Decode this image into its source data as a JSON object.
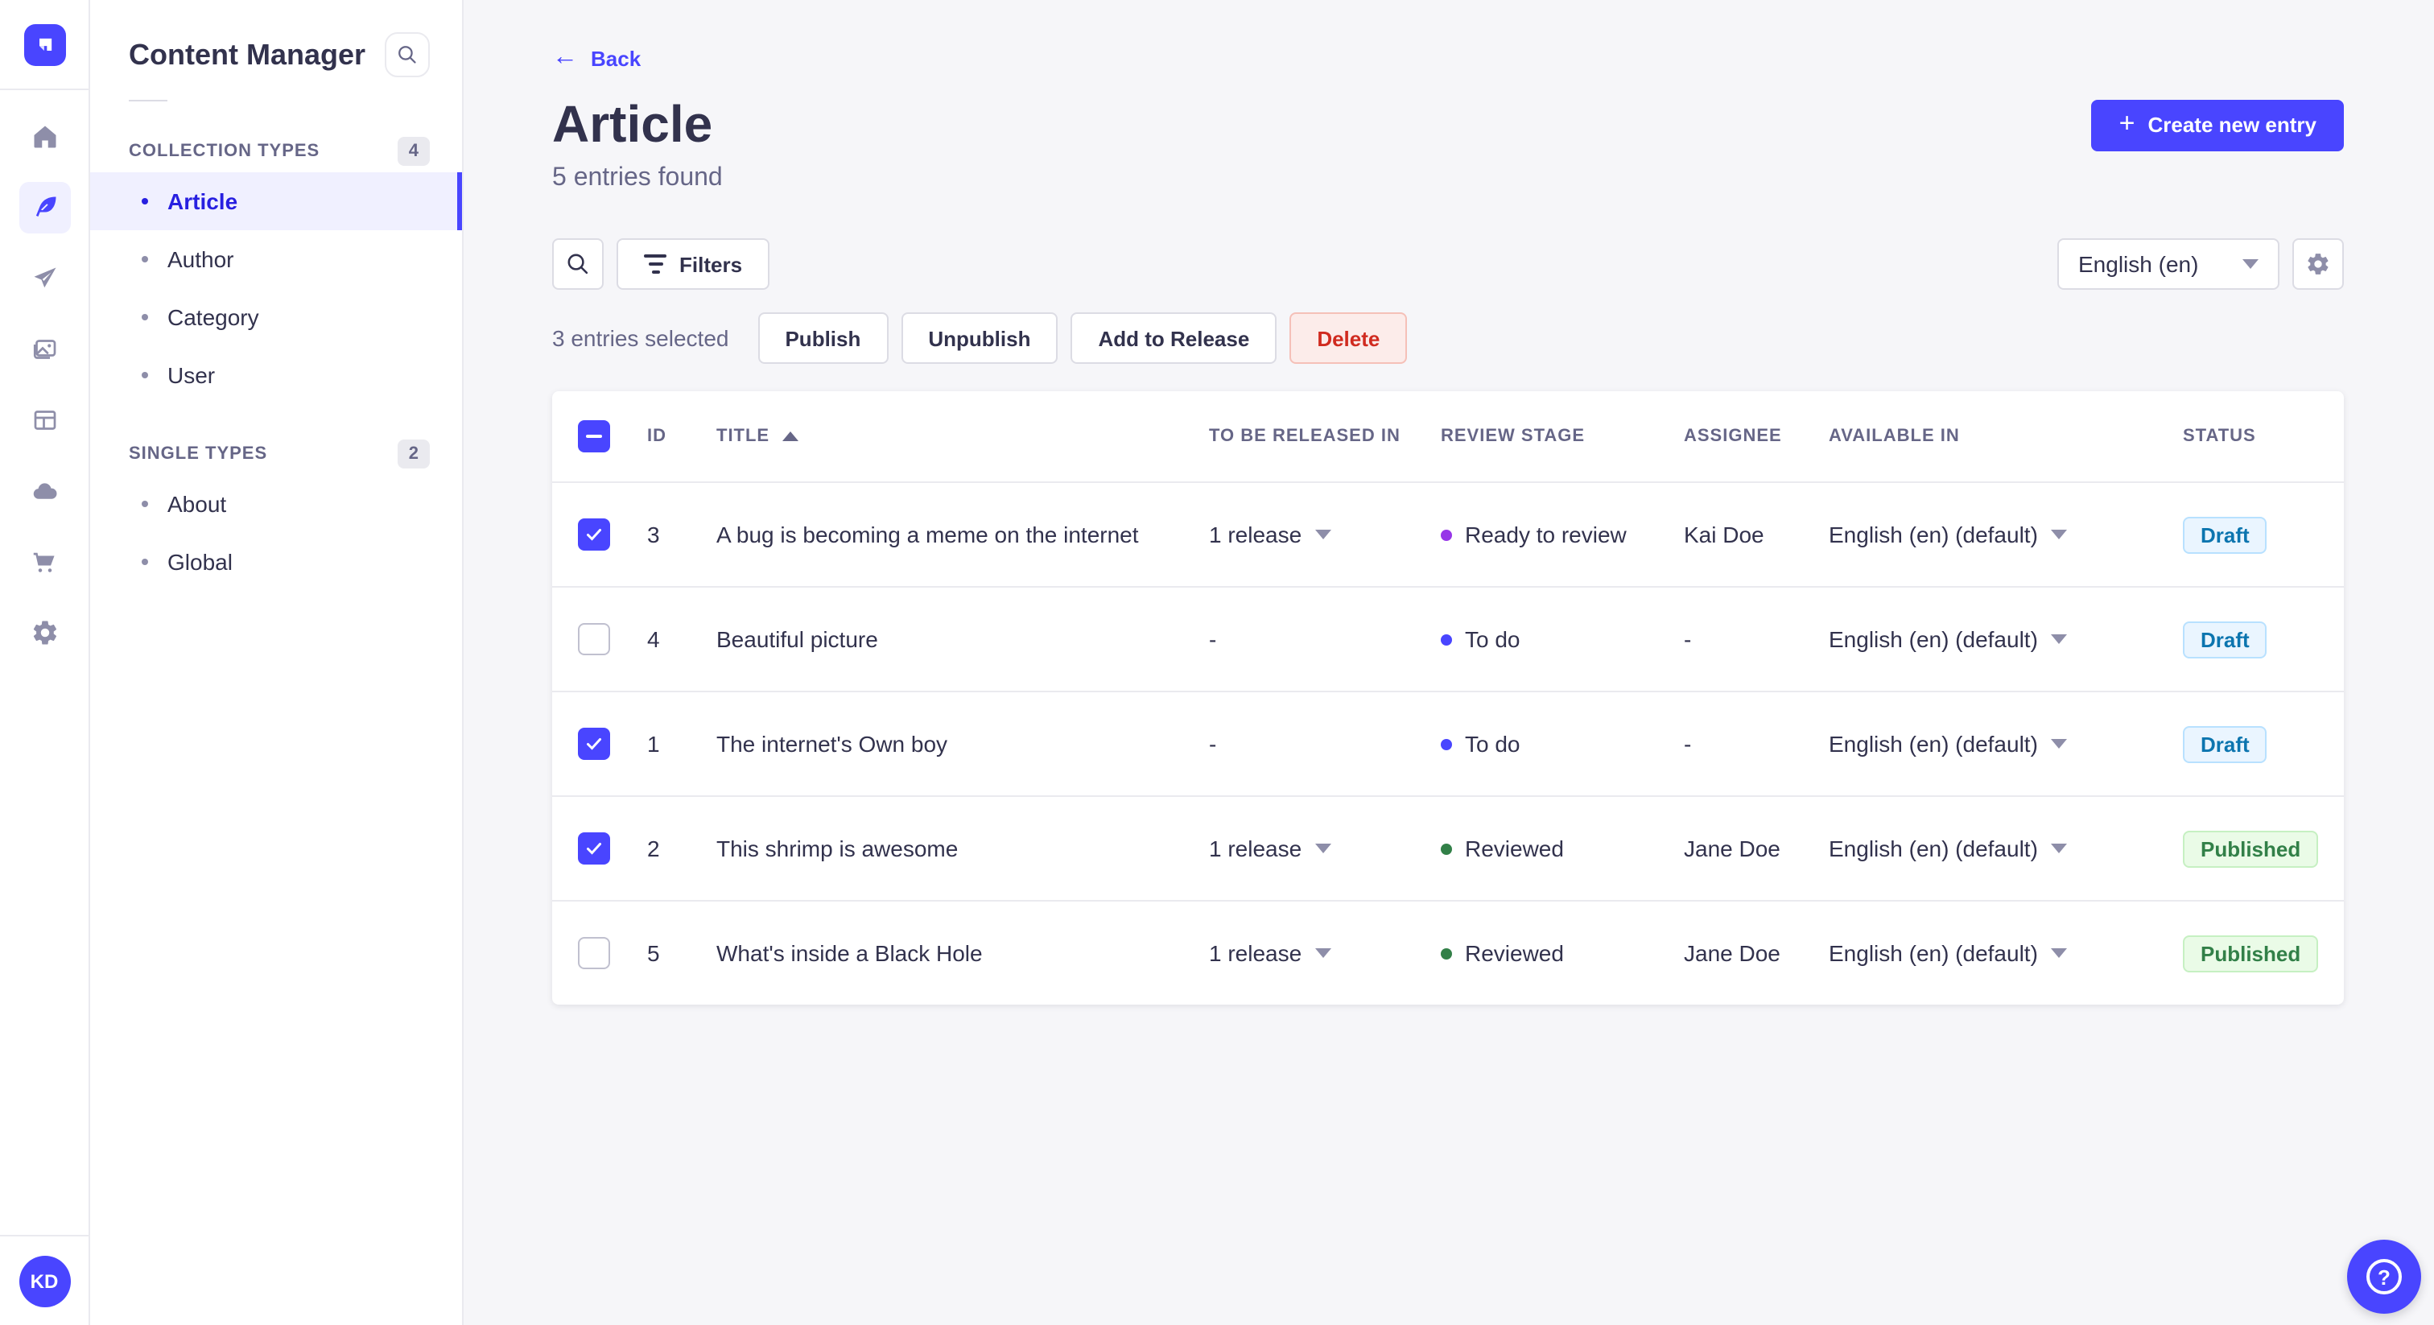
{
  "colors": {
    "primary": "#4945FF",
    "active_text": "#271FE0",
    "draft_text": "#0C75AF",
    "published_text": "#328048",
    "danger_text": "#D02B20"
  },
  "rail": {
    "icons": [
      "strapi-logo-icon",
      "home-icon",
      "feather-content-icon",
      "paper-plane-icon",
      "media-images-icon",
      "layout-icon",
      "cloud-icon",
      "cart-icon",
      "gear-icon"
    ],
    "avatar_initials": "KD"
  },
  "subnav": {
    "title": "Content Manager",
    "search_icon": "search-icon",
    "sections": [
      {
        "label": "COLLECTION TYPES",
        "count": "4",
        "items": [
          {
            "label": "Article",
            "active": true
          },
          {
            "label": "Author",
            "active": false
          },
          {
            "label": "Category",
            "active": false
          },
          {
            "label": "User",
            "active": false
          }
        ]
      },
      {
        "label": "SINGLE TYPES",
        "count": "2",
        "items": [
          {
            "label": "About",
            "active": false
          },
          {
            "label": "Global",
            "active": false
          }
        ]
      }
    ]
  },
  "header": {
    "back_label": "Back",
    "back_arrow": "←",
    "title": "Article",
    "subtitle": "5 entries found",
    "create_label": "Create new entry",
    "create_plus": "+"
  },
  "toolbar": {
    "filters_label": "Filters",
    "locale_value": "English (en)"
  },
  "selection": {
    "text": "3 entries selected",
    "publish_label": "Publish",
    "unpublish_label": "Unpublish",
    "add_to_release_label": "Add to Release",
    "delete_label": "Delete"
  },
  "table": {
    "headers": {
      "id": "ID",
      "title": "TITLE",
      "to_be_released_in": "TO BE RELEASED IN",
      "review_stage": "REVIEW STAGE",
      "assignee": "ASSIGNEE",
      "available_in": "AVAILABLE IN",
      "status": "STATUS"
    },
    "sort": {
      "column": "TITLE",
      "direction": "asc"
    },
    "header_checkbox_state": "indeterminate",
    "rows": [
      {
        "checked": true,
        "id": "3",
        "title": "A bug is becoming a meme on the internet",
        "release": "1 release",
        "has_release": true,
        "stage": "Ready to review",
        "stage_color": "#9736E8",
        "assignee": "Kai Doe",
        "locale": "English (en) (default)",
        "status": "Draft",
        "status_variant": "draft"
      },
      {
        "checked": false,
        "id": "4",
        "title": "Beautiful picture",
        "release": "-",
        "has_release": false,
        "stage": "To do",
        "stage_color": "#4945FF",
        "assignee": "-",
        "locale": "English (en) (default)",
        "status": "Draft",
        "status_variant": "draft"
      },
      {
        "checked": true,
        "id": "1",
        "title": "The internet's Own boy",
        "release": "-",
        "has_release": false,
        "stage": "To do",
        "stage_color": "#4945FF",
        "assignee": "-",
        "locale": "English (en) (default)",
        "status": "Draft",
        "status_variant": "draft"
      },
      {
        "checked": true,
        "id": "2",
        "title": "This shrimp is awesome",
        "release": "1 release",
        "has_release": true,
        "stage": "Reviewed",
        "stage_color": "#328048",
        "assignee": "Jane Doe",
        "locale": "English (en) (default)",
        "status": "Published",
        "status_variant": "published"
      },
      {
        "checked": false,
        "id": "5",
        "title": "What's inside a Black Hole",
        "release": "1 release",
        "has_release": true,
        "stage": "Reviewed",
        "stage_color": "#328048",
        "assignee": "Jane Doe",
        "locale": "English (en) (default)",
        "status": "Published",
        "status_variant": "published"
      }
    ]
  },
  "help": {
    "icon": "question-circle-icon",
    "glyph": "?"
  }
}
